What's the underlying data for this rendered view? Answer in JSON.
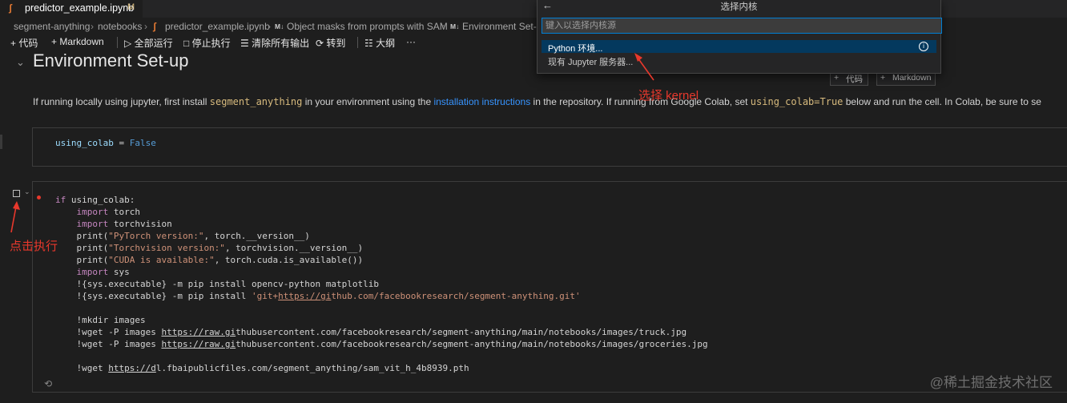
{
  "tab": {
    "icon": "notebook-icon",
    "title": "predictor_example.ipynb",
    "modified": "M"
  },
  "breadcrumb": {
    "items": [
      "segment-anything",
      "notebooks",
      "predictor_example.ipynb",
      "Object masks from prompts with SAM",
      "Environment Set-u"
    ],
    "md_marker": "M↓"
  },
  "toolbar": {
    "code": "代码",
    "markdown": "Markdown",
    "run_all": "全部运行",
    "stop": "停止执行",
    "clear": "清除所有输出",
    "goto": "转到",
    "outline": "大纲",
    "more": "···"
  },
  "markdown_cell": {
    "heading": "Environment Set-up",
    "text_prefix": "If running locally using jupyter, first install ",
    "code1": "segment_anything",
    "text_mid1": " in your environment using the ",
    "link": "installation instructions",
    "text_mid2": " in the repository. If running from Google Colab, set ",
    "code2": "using_colab=True",
    "text_suffix": " below and run the cell. In Colab, be sure to se"
  },
  "cell_buttons": {
    "code": "代码",
    "markdown": "Markdown"
  },
  "code_cell_1": {
    "line": "using_colab = False"
  },
  "code_cell_2": {
    "lines": [
      "if using_colab:",
      "    import torch",
      "    import torchvision",
      "    print(\"PyTorch version:\", torch.__version__)",
      "    print(\"Torchvision version:\", torchvision.__version__)",
      "    print(\"CUDA is available:\", torch.cuda.is_available())",
      "    import sys",
      "    !{sys.executable} -m pip install opencv-python matplotlib",
      "    !{sys.executable} -m pip install 'git+https://github.com/facebookresearch/segment-anything.git'",
      "",
      "    !mkdir images",
      "    !wget -P images https://raw.githubusercontent.com/facebookresearch/segment-anything/main/notebooks/images/truck.jpg",
      "    !wget -P images https://raw.githubusercontent.com/facebookresearch/segment-anything/main/notebooks/images/groceries.jpg",
      "",
      "    !wget https://dl.fbaipublicfiles.com/segment_anything/sam_vit_h_4b8939.pth"
    ]
  },
  "quick_pick": {
    "title": "选择内核",
    "placeholder": "键入以选择内核源",
    "items": [
      "Python 环境...",
      "现有 Jupyter 服务器..."
    ]
  },
  "annotations": {
    "select_kernel": "选择 kernel",
    "click_run": "点击执行"
  },
  "watermark": "@稀土掘金技术社区",
  "colors": {
    "accent": "#007fd4",
    "selected": "#04395e",
    "annotation": "#e8382c"
  }
}
